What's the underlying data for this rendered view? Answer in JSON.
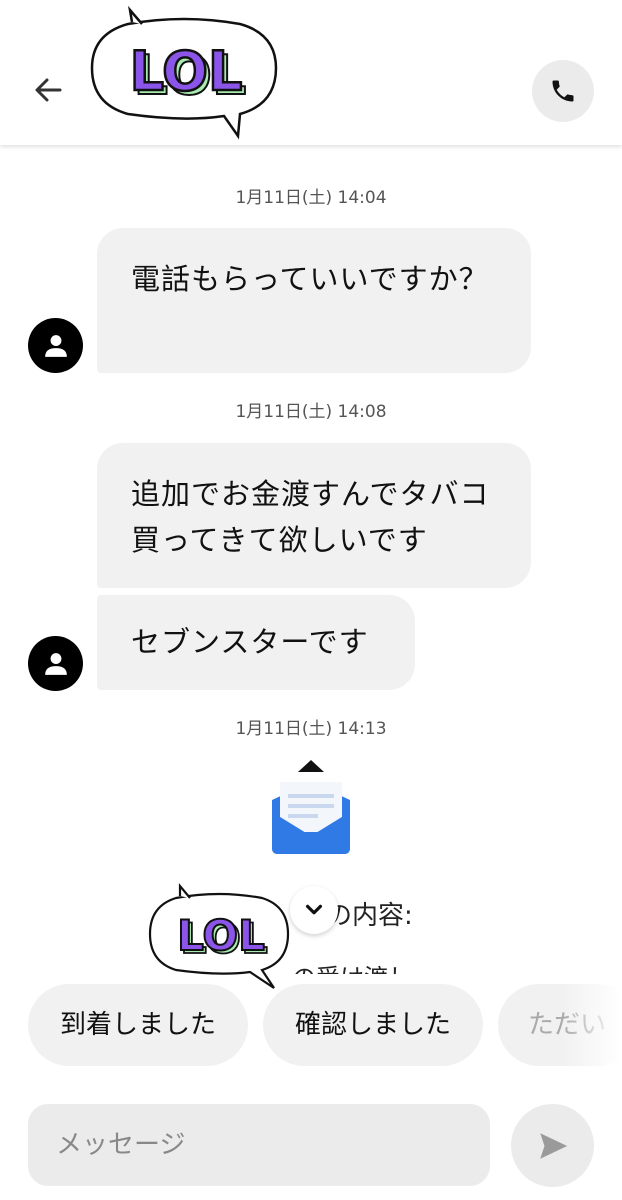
{
  "header": {
    "back_icon": "arrow-left-icon",
    "call_icon": "phone-icon",
    "sticker_text": "LOL"
  },
  "messages": [
    {
      "timestamp": "1月11日(土) 14:04",
      "text": "電話もらっていいですか？"
    },
    {
      "timestamp": "1月11日(土) 14:08",
      "texts": [
        "追加でお金渡すんでタバコ買ってきて欲しいです",
        "セブンスターです"
      ]
    },
    {
      "timestamp": "1月11日(土) 14:13",
      "card_text_partial": "示の内容:",
      "card_text_partial2": "の受け渡し"
    }
  ],
  "overlay_sticker_text": "LOL",
  "quick_replies": [
    "到着しました",
    "確認しました",
    "ただい"
  ],
  "composer": {
    "placeholder": "メッセージ",
    "send_icon": "send-icon"
  },
  "colors": {
    "sticker_purple": "#8a55e8",
    "sticker_green": "#a8ebb0",
    "envelope_blue": "#2f7ae5"
  }
}
